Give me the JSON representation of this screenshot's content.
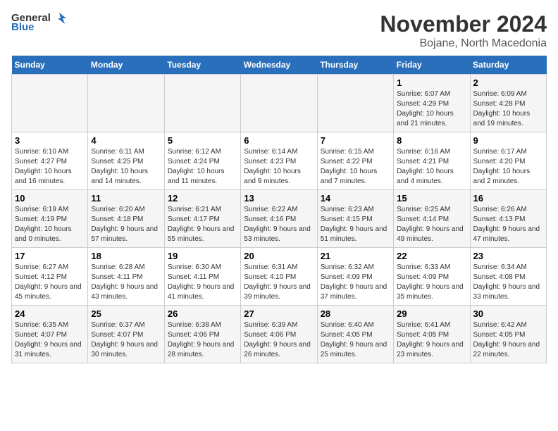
{
  "header": {
    "logo_general": "General",
    "logo_blue": "Blue",
    "month": "November 2024",
    "location": "Bojane, North Macedonia"
  },
  "weekdays": [
    "Sunday",
    "Monday",
    "Tuesday",
    "Wednesday",
    "Thursday",
    "Friday",
    "Saturday"
  ],
  "weeks": [
    [
      {
        "day": "",
        "info": ""
      },
      {
        "day": "",
        "info": ""
      },
      {
        "day": "",
        "info": ""
      },
      {
        "day": "",
        "info": ""
      },
      {
        "day": "",
        "info": ""
      },
      {
        "day": "1",
        "info": "Sunrise: 6:07 AM\nSunset: 4:29 PM\nDaylight: 10 hours and 21 minutes."
      },
      {
        "day": "2",
        "info": "Sunrise: 6:09 AM\nSunset: 4:28 PM\nDaylight: 10 hours and 19 minutes."
      }
    ],
    [
      {
        "day": "3",
        "info": "Sunrise: 6:10 AM\nSunset: 4:27 PM\nDaylight: 10 hours and 16 minutes."
      },
      {
        "day": "4",
        "info": "Sunrise: 6:11 AM\nSunset: 4:25 PM\nDaylight: 10 hours and 14 minutes."
      },
      {
        "day": "5",
        "info": "Sunrise: 6:12 AM\nSunset: 4:24 PM\nDaylight: 10 hours and 11 minutes."
      },
      {
        "day": "6",
        "info": "Sunrise: 6:14 AM\nSunset: 4:23 PM\nDaylight: 10 hours and 9 minutes."
      },
      {
        "day": "7",
        "info": "Sunrise: 6:15 AM\nSunset: 4:22 PM\nDaylight: 10 hours and 7 minutes."
      },
      {
        "day": "8",
        "info": "Sunrise: 6:16 AM\nSunset: 4:21 PM\nDaylight: 10 hours and 4 minutes."
      },
      {
        "day": "9",
        "info": "Sunrise: 6:17 AM\nSunset: 4:20 PM\nDaylight: 10 hours and 2 minutes."
      }
    ],
    [
      {
        "day": "10",
        "info": "Sunrise: 6:19 AM\nSunset: 4:19 PM\nDaylight: 10 hours and 0 minutes."
      },
      {
        "day": "11",
        "info": "Sunrise: 6:20 AM\nSunset: 4:18 PM\nDaylight: 9 hours and 57 minutes."
      },
      {
        "day": "12",
        "info": "Sunrise: 6:21 AM\nSunset: 4:17 PM\nDaylight: 9 hours and 55 minutes."
      },
      {
        "day": "13",
        "info": "Sunrise: 6:22 AM\nSunset: 4:16 PM\nDaylight: 9 hours and 53 minutes."
      },
      {
        "day": "14",
        "info": "Sunrise: 6:23 AM\nSunset: 4:15 PM\nDaylight: 9 hours and 51 minutes."
      },
      {
        "day": "15",
        "info": "Sunrise: 6:25 AM\nSunset: 4:14 PM\nDaylight: 9 hours and 49 minutes."
      },
      {
        "day": "16",
        "info": "Sunrise: 6:26 AM\nSunset: 4:13 PM\nDaylight: 9 hours and 47 minutes."
      }
    ],
    [
      {
        "day": "17",
        "info": "Sunrise: 6:27 AM\nSunset: 4:12 PM\nDaylight: 9 hours and 45 minutes."
      },
      {
        "day": "18",
        "info": "Sunrise: 6:28 AM\nSunset: 4:11 PM\nDaylight: 9 hours and 43 minutes."
      },
      {
        "day": "19",
        "info": "Sunrise: 6:30 AM\nSunset: 4:11 PM\nDaylight: 9 hours and 41 minutes."
      },
      {
        "day": "20",
        "info": "Sunrise: 6:31 AM\nSunset: 4:10 PM\nDaylight: 9 hours and 39 minutes."
      },
      {
        "day": "21",
        "info": "Sunrise: 6:32 AM\nSunset: 4:09 PM\nDaylight: 9 hours and 37 minutes."
      },
      {
        "day": "22",
        "info": "Sunrise: 6:33 AM\nSunset: 4:09 PM\nDaylight: 9 hours and 35 minutes."
      },
      {
        "day": "23",
        "info": "Sunrise: 6:34 AM\nSunset: 4:08 PM\nDaylight: 9 hours and 33 minutes."
      }
    ],
    [
      {
        "day": "24",
        "info": "Sunrise: 6:35 AM\nSunset: 4:07 PM\nDaylight: 9 hours and 31 minutes."
      },
      {
        "day": "25",
        "info": "Sunrise: 6:37 AM\nSunset: 4:07 PM\nDaylight: 9 hours and 30 minutes."
      },
      {
        "day": "26",
        "info": "Sunrise: 6:38 AM\nSunset: 4:06 PM\nDaylight: 9 hours and 28 minutes."
      },
      {
        "day": "27",
        "info": "Sunrise: 6:39 AM\nSunset: 4:06 PM\nDaylight: 9 hours and 26 minutes."
      },
      {
        "day": "28",
        "info": "Sunrise: 6:40 AM\nSunset: 4:05 PM\nDaylight: 9 hours and 25 minutes."
      },
      {
        "day": "29",
        "info": "Sunrise: 6:41 AM\nSunset: 4:05 PM\nDaylight: 9 hours and 23 minutes."
      },
      {
        "day": "30",
        "info": "Sunrise: 6:42 AM\nSunset: 4:05 PM\nDaylight: 9 hours and 22 minutes."
      }
    ]
  ]
}
